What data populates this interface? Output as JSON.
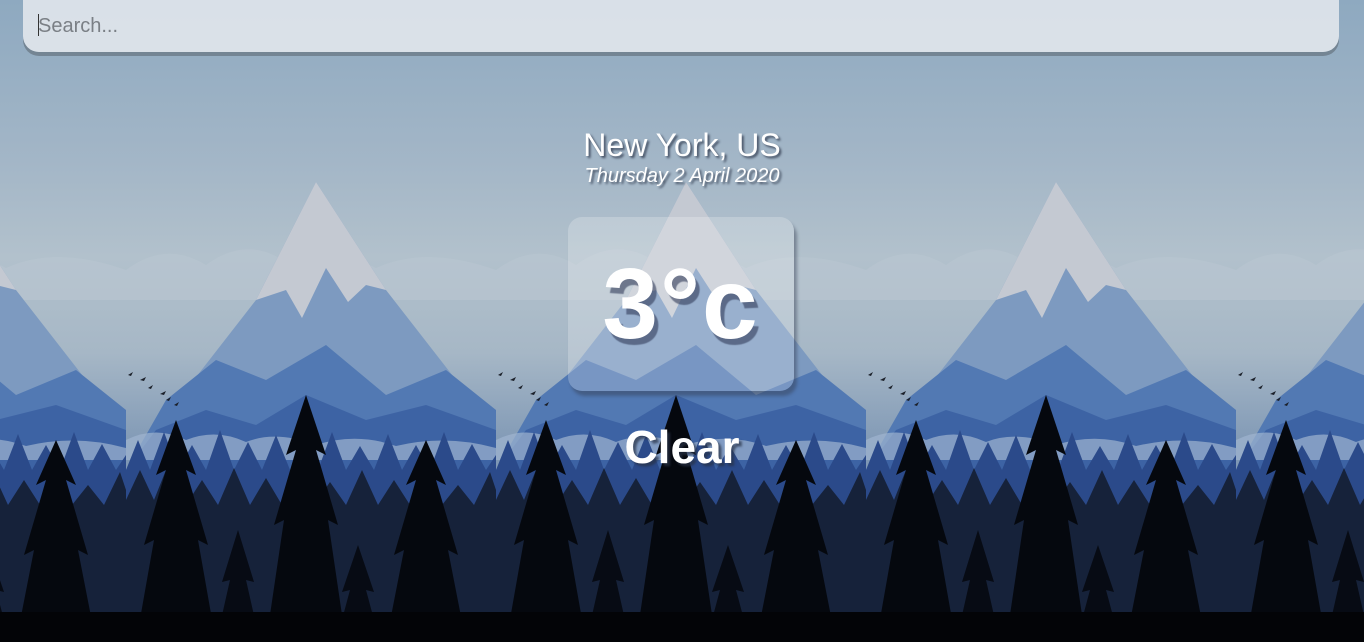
{
  "search": {
    "placeholder": "Search...",
    "value": ""
  },
  "location": {
    "city": "New York, US",
    "date": "Thursday 2 April 2020"
  },
  "weather": {
    "temperature": "3°c",
    "condition": "Clear"
  },
  "colors": {
    "sky": "#8ea9c0",
    "mountain_snow": "#c7ccd4",
    "mountain_blue": "#3f6aa8",
    "forest_dark": "#0d1420",
    "text": "#ffffff"
  }
}
